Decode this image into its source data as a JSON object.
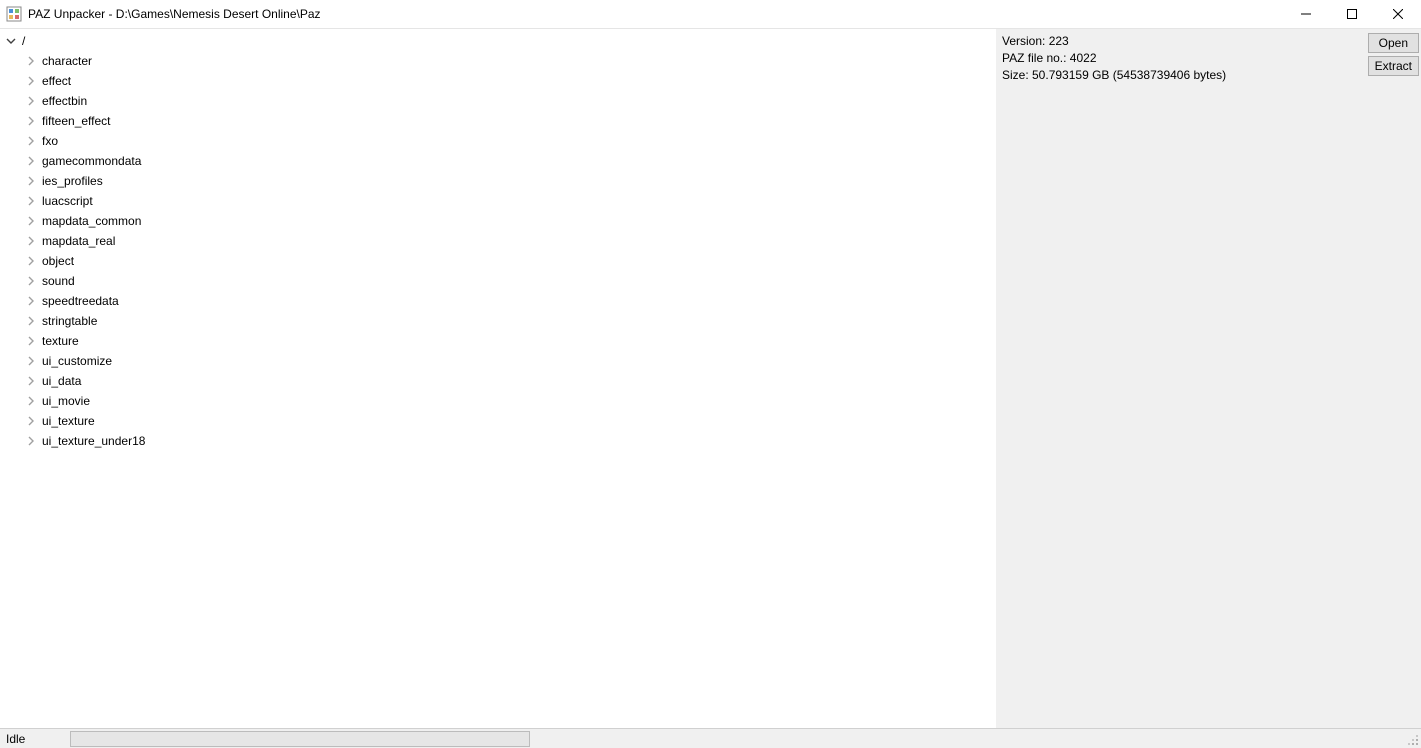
{
  "window": {
    "title": "PAZ Unpacker - D:\\Games\\Nemesis Desert Online\\Paz"
  },
  "tree": {
    "root_label": "/",
    "items": [
      "character",
      "effect",
      "effectbin",
      "fifteen_effect",
      "fxo",
      "gamecommondata",
      "ies_profiles",
      "luacscript",
      "mapdata_common",
      "mapdata_real",
      "object",
      "sound",
      "speedtreedata",
      "stringtable",
      "texture",
      "ui_customize",
      "ui_data",
      "ui_movie",
      "ui_texture",
      "ui_texture_under18"
    ]
  },
  "info": {
    "version": "Version: 223",
    "fileno": "PAZ file no.: 4022",
    "size": "Size: 50.793159 GB (54538739406 bytes)"
  },
  "buttons": {
    "open": "Open",
    "extract": "Extract"
  },
  "status": {
    "text": "Idle"
  }
}
